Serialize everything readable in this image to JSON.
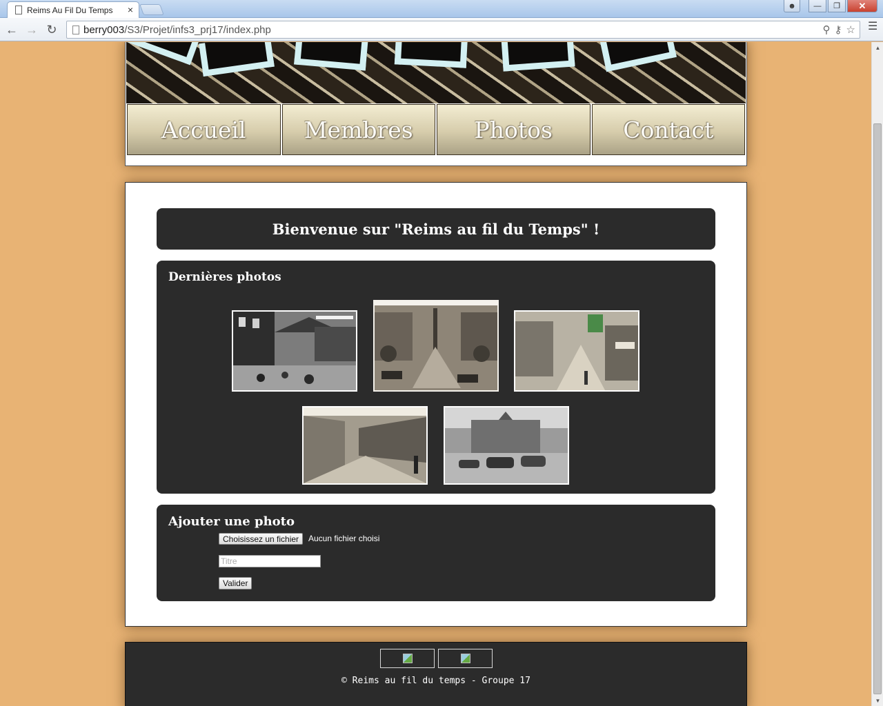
{
  "browser": {
    "tab_title": "Reims Au Fil Du Temps",
    "tab_close": "×",
    "url_host": "berry003",
    "url_path": "/S3/Projet/infs3_prj17/index.php",
    "icons": [
      "back-icon",
      "forward-icon",
      "reload-icon",
      "search-icon",
      "key-icon",
      "star-icon",
      "wrench-icon"
    ]
  },
  "nav": {
    "items": [
      {
        "label": "Accueil"
      },
      {
        "label": "Membres"
      },
      {
        "label": "Photos"
      },
      {
        "label": "Contact"
      }
    ]
  },
  "main": {
    "welcome": "Bienvenue sur \"Reims au fil du Temps\" !",
    "latest_photos_title": "Dernières photos",
    "upload": {
      "title": "Ajouter une photo",
      "file_button": "Choisissez un fichier",
      "file_status": "Aucun fichier choisi",
      "title_placeholder": "Titre",
      "submit": "Valider"
    }
  },
  "footer": {
    "copyright": "© Reims au fil du temps - Groupe 17"
  },
  "colors": {
    "page_background": "#e8b374",
    "panel": "#2b2b2b",
    "nav_gradient_top": "#f3edd2",
    "nav_gradient_bottom": "#aaa286"
  }
}
